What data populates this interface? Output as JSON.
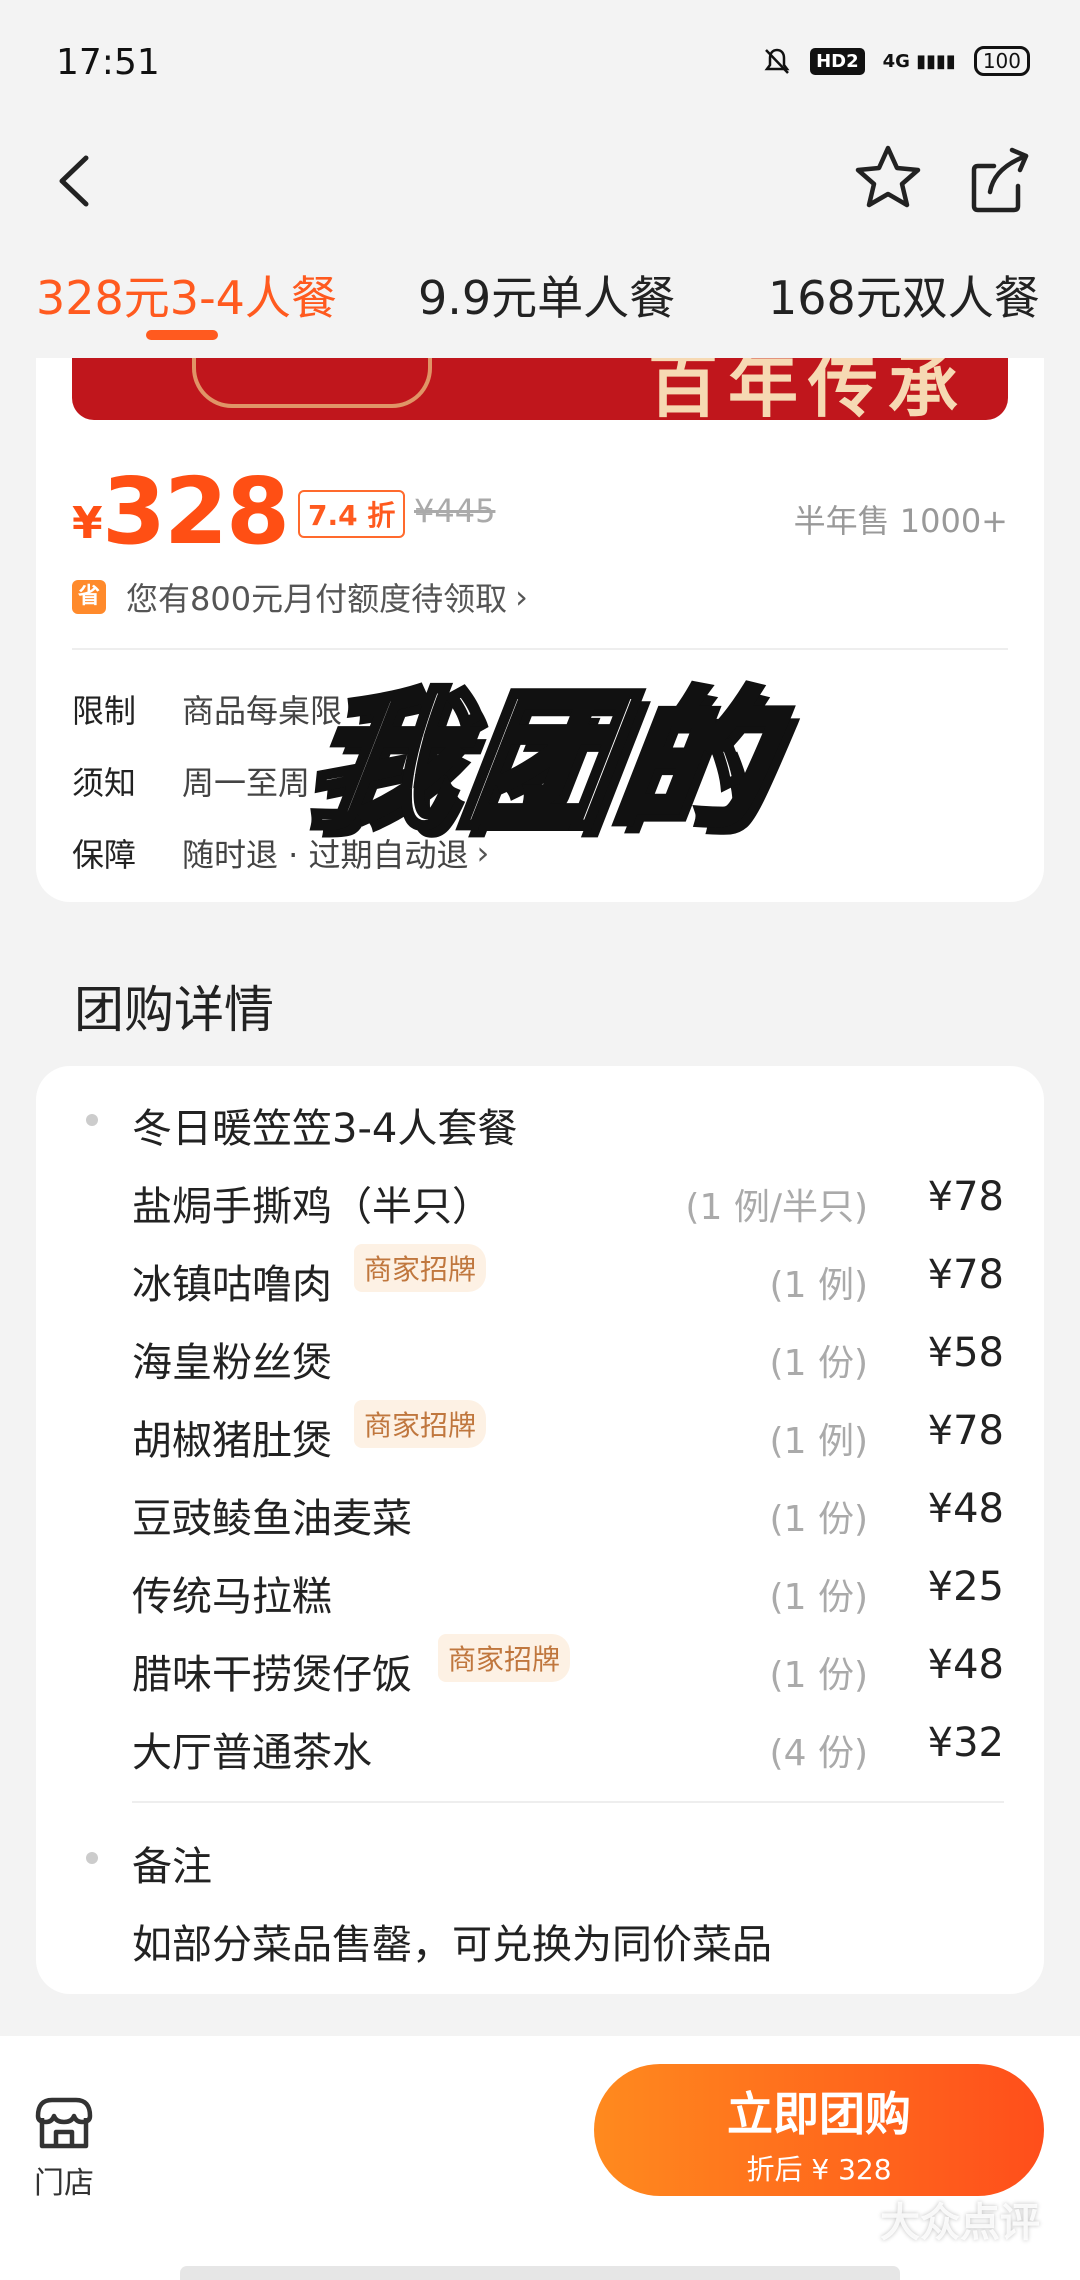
{
  "status_bar": {
    "time": "17:51",
    "hd": "HD2",
    "network": "4G",
    "battery": "100"
  },
  "tabs": [
    {
      "label": "328元3-4人餐",
      "active": true
    },
    {
      "label": "9.9元单人餐",
      "active": false
    },
    {
      "label": "168元双人餐",
      "active": false
    }
  ],
  "banner": {
    "text": "百年传承"
  },
  "deal": {
    "currency": "¥",
    "price": "328",
    "discount": "7.4 折",
    "original_price": "¥445",
    "sold": "半年售 1000+",
    "credit_icon": "省",
    "credit_text": "您有800元月付额度待领取"
  },
  "info": [
    {
      "label": "限制",
      "value": "商品每桌限"
    },
    {
      "label": "须知",
      "value": "周一至周"
    },
    {
      "label": "保障",
      "value": "随时退 · 过期自动退"
    }
  ],
  "overlay_text": "我团的",
  "section": {
    "title": "团购详情"
  },
  "package": {
    "title": "冬日暖笠笠3-4人套餐",
    "tag_label": "商家招牌",
    "items": [
      {
        "name": "盐焗手撕鸡（半只）",
        "qty": "(1 例/半只)",
        "price": "¥78",
        "tag": false
      },
      {
        "name": "冰镇咕噜肉",
        "qty": "(1 例)",
        "price": "¥78",
        "tag": true
      },
      {
        "name": "海皇粉丝煲",
        "qty": "(1 份)",
        "price": "¥58",
        "tag": false
      },
      {
        "name": "胡椒猪肚煲",
        "qty": "(1 例)",
        "price": "¥78",
        "tag": true
      },
      {
        "name": "豆豉鲮鱼油麦菜",
        "qty": "(1 份)",
        "price": "¥48",
        "tag": false
      },
      {
        "name": "传统马拉糕",
        "qty": "(1 份)",
        "price": "¥25",
        "tag": false
      },
      {
        "name": "腊味干捞煲仔饭",
        "qty": "(1 份)",
        "price": "¥48",
        "tag": true
      },
      {
        "name": "大厅普通茶水",
        "qty": "(4 份)",
        "price": "¥32",
        "tag": false
      }
    ]
  },
  "remark": {
    "title": "备注",
    "text": "如部分菜品售罄，可兑换为同价菜品"
  },
  "bottom": {
    "store_label": "门店",
    "buy_label": "立即团购",
    "buy_sub": "折后 ¥ 328",
    "watermark": "大众点评"
  },
  "colors": {
    "accent": "#ff5a1f",
    "tag_text": "#c0773e",
    "tag_bg": "#fdf1e4"
  }
}
